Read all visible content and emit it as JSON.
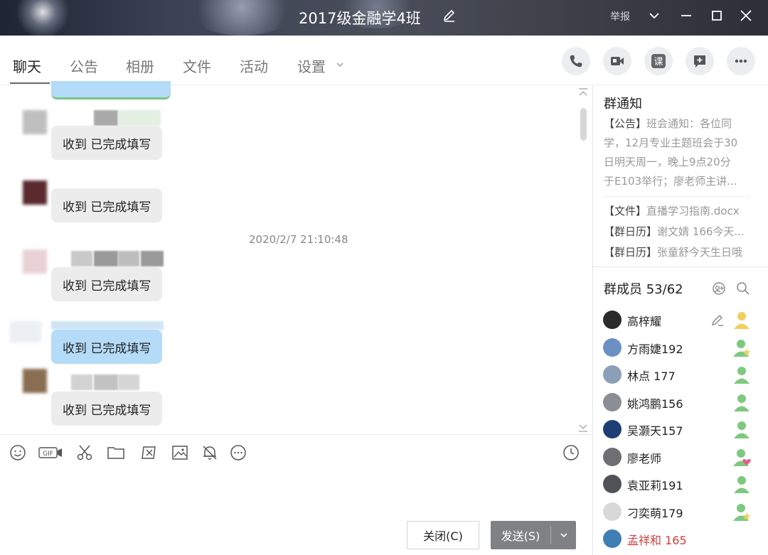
{
  "window": {
    "title": "2017级金融学4班",
    "report_label": "举报"
  },
  "tabs": [
    {
      "label": "聊天",
      "active": true
    },
    {
      "label": "公告"
    },
    {
      "label": "相册"
    },
    {
      "label": "文件"
    },
    {
      "label": "活动"
    },
    {
      "label": "设置"
    }
  ],
  "toolbar_icons": [
    "phone-icon",
    "video-icon",
    "class-icon",
    "add-app-icon",
    "more-icon"
  ],
  "toolbar_class_label": "课",
  "chat": {
    "messages": [
      {
        "text": "收到 已完成填写",
        "style": "gray"
      },
      {
        "text": "收到 已完成填写",
        "style": "gray"
      },
      {
        "text": "收到 已完成填写",
        "style": "gray"
      },
      {
        "text": "收到 已完成填写",
        "style": "blue"
      },
      {
        "text": "收到 已完成填写",
        "style": "gray"
      }
    ],
    "timestamp": "2020/2/7 21:10:48"
  },
  "input_tools": [
    "emoji-icon",
    "gif-icon",
    "scissors-icon",
    "folder-icon",
    "screenshot-icon",
    "image-icon",
    "bell-off-icon",
    "more-circle-icon",
    "history-clock-icon"
  ],
  "input_gif_label": "GIF",
  "buttons": {
    "close_label": "关闭(C)",
    "send_label": "发送(S)"
  },
  "group_notice": {
    "title": "群通知",
    "announcement_tag": "【公告】",
    "announcement_lines": [
      "班会通知：各位同",
      "学，12月专业主题班会于30",
      "日明天周一，晚上9点20分",
      "于E103举行；廖老师主讲..."
    ],
    "file_tag": "【文件】",
    "file_name": "直播学习指南.docx",
    "calendar_tag_1": "【群日历】",
    "calendar_text_1": "谢文婧 166今天...",
    "calendar_tag_2": "【群日历】",
    "calendar_text_2": "张童舒今天生日哦"
  },
  "members": {
    "title": "群成员 53/62",
    "list": [
      {
        "name": "高梓耀",
        "red": false,
        "avatar_color": "#2b2b2b"
      },
      {
        "name": "方雨婕192",
        "red": false,
        "avatar_color": "#6d90c4"
      },
      {
        "name": "林点 177",
        "red": false,
        "avatar_color": "#8ba0b6"
      },
      {
        "name": "姚鸿鹏156",
        "red": false,
        "avatar_color": "#8a8f95"
      },
      {
        "name": "吴灏天157",
        "red": false,
        "avatar_color": "#1d3f74"
      },
      {
        "name": "廖老师",
        "red": false,
        "avatar_color": "#6f6f73"
      },
      {
        "name": "袁亚莉191",
        "red": false,
        "avatar_color": "#505257"
      },
      {
        "name": "刁奕萌179",
        "red": false,
        "avatar_color": "#d8d8d8"
      },
      {
        "name": "孟祥和 165",
        "red": true,
        "avatar_color": "#3f7fb3"
      }
    ]
  },
  "colors": {
    "send_button": "#7f8184",
    "blue_bubble": "#b4dbf7",
    "gray_bubble": "#ececec",
    "red_name": "#d23c3c"
  }
}
